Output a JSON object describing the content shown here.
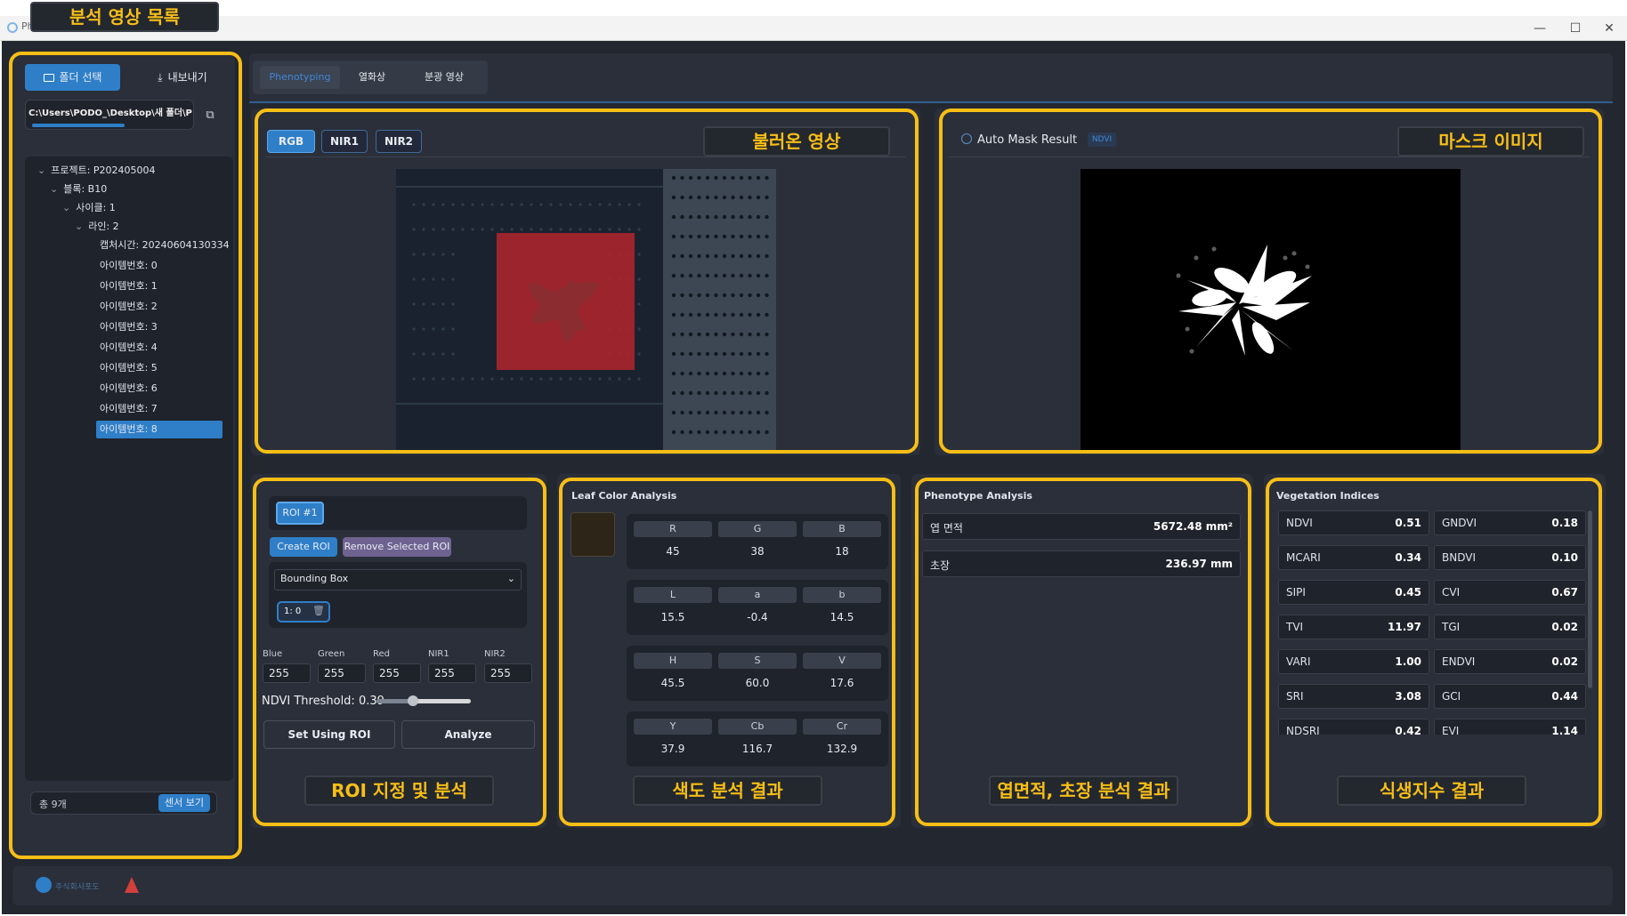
{
  "window": {
    "title": "Ph",
    "controls": [
      "—",
      "☐",
      "✕"
    ]
  },
  "callouts": {
    "list": "분석 영상 목록",
    "loaded_image": "불러온 영상",
    "mask_image": "마스크 이미지",
    "roi": "ROI 지정 및 분석",
    "color": "색도 분석 결과",
    "pheno": "엽면적, 초장 분석 결과",
    "veg": "식생지수 결과"
  },
  "sidebar": {
    "folder_button": "폴더 선택",
    "export_button": "내보내기",
    "path": "C:\\Users\\PODO_\\Desktop\\새 폴더\\Pheno",
    "tree": [
      {
        "label": "프로젝트: P202405004",
        "level": 0,
        "toggle": "⌄"
      },
      {
        "label": "블록: B10",
        "level": 1,
        "toggle": "⌄"
      },
      {
        "label": "사이클: 1",
        "level": 2,
        "toggle": "⌄"
      },
      {
        "label": "라인: 2",
        "level": 3,
        "toggle": "⌄"
      },
      {
        "label": "캡처시간: 20240604130334",
        "level": 4,
        "toggle": ""
      },
      {
        "label": "아이템번호: 0",
        "level": 4,
        "toggle": ""
      },
      {
        "label": "아이템번호: 1",
        "level": 4,
        "toggle": ""
      },
      {
        "label": "아이템번호: 2",
        "level": 4,
        "toggle": ""
      },
      {
        "label": "아이템번호: 3",
        "level": 4,
        "toggle": ""
      },
      {
        "label": "아이템번호: 4",
        "level": 4,
        "toggle": ""
      },
      {
        "label": "아이템번호: 5",
        "level": 4,
        "toggle": ""
      },
      {
        "label": "아이템번호: 6",
        "level": 4,
        "toggle": ""
      },
      {
        "label": "아이템번호: 7",
        "level": 4,
        "toggle": ""
      },
      {
        "label": "아이템번호: 8",
        "level": 4,
        "toggle": "",
        "selected": true
      }
    ],
    "count": "총 9개",
    "sensor_button": "센서 보기"
  },
  "tabs": [
    "Phenotyping",
    "열화상",
    "분광 영상"
  ],
  "active_tab": "Phenotyping",
  "image_panel": {
    "channels": [
      "RGB",
      "NIR1",
      "NIR2"
    ],
    "active_channel": "RGB"
  },
  "mask_panel": {
    "radio_label": "Auto Mask Result",
    "badge": "NDVI"
  },
  "roi": {
    "tag": "ROI #1",
    "create": "Create ROI",
    "remove": "Remove Selected ROI",
    "mode": "Bounding Box",
    "item": "1: 0",
    "fields": [
      {
        "label": "Blue",
        "value": "255"
      },
      {
        "label": "Green",
        "value": "255"
      },
      {
        "label": "Red",
        "value": "255"
      },
      {
        "label": "NIR1",
        "value": "255"
      },
      {
        "label": "NIR2",
        "value": "255"
      }
    ],
    "threshold_label": "NDVI Threshold: 0.39",
    "threshold_value": 0.39,
    "set_button": "Set Using ROI",
    "analyze_button": "Analyze"
  },
  "leaf_color": {
    "title": "Leaf Color Analysis",
    "swatch": "#2d2618",
    "groups": [
      {
        "heads": [
          "R",
          "G",
          "B"
        ],
        "values": [
          "45",
          "38",
          "18"
        ]
      },
      {
        "heads": [
          "L",
          "a",
          "b"
        ],
        "values": [
          "15.5",
          "-0.4",
          "14.5"
        ]
      },
      {
        "heads": [
          "H",
          "S",
          "V"
        ],
        "values": [
          "45.5",
          "60.0",
          "17.6"
        ]
      },
      {
        "heads": [
          "Y",
          "Cb",
          "Cr"
        ],
        "values": [
          "37.9",
          "116.7",
          "132.9"
        ]
      }
    ]
  },
  "phenotype": {
    "title": "Phenotype Analysis",
    "rows": [
      {
        "name": "엽 면적",
        "value": "5672.48 mm²"
      },
      {
        "name": "초장",
        "value": "236.97 mm"
      }
    ]
  },
  "vegetation": {
    "title": "Vegetation Indices",
    "left": [
      {
        "name": "NDVI",
        "value": "0.51"
      },
      {
        "name": "MCARI",
        "value": "0.34"
      },
      {
        "name": "SIPI",
        "value": "0.45"
      },
      {
        "name": "TVI",
        "value": "11.97"
      },
      {
        "name": "VARI",
        "value": "1.00"
      },
      {
        "name": "SRI",
        "value": "3.08"
      },
      {
        "name": "NDSRI",
        "value": "0.42"
      }
    ],
    "right": [
      {
        "name": "GNDVI",
        "value": "0.18"
      },
      {
        "name": "BNDVI",
        "value": "0.10"
      },
      {
        "name": "CVI",
        "value": "0.67"
      },
      {
        "name": "TGI",
        "value": "0.02"
      },
      {
        "name": "ENDVI",
        "value": "0.02"
      },
      {
        "name": "GCI",
        "value": "0.44"
      },
      {
        "name": "EVI",
        "value": "1.14"
      }
    ]
  },
  "footer": {
    "logo_text": "주식회사포도"
  },
  "colors": {
    "accent": "#2f7fc8",
    "callout": "#f7be16",
    "roi_red": "#b3252d"
  }
}
